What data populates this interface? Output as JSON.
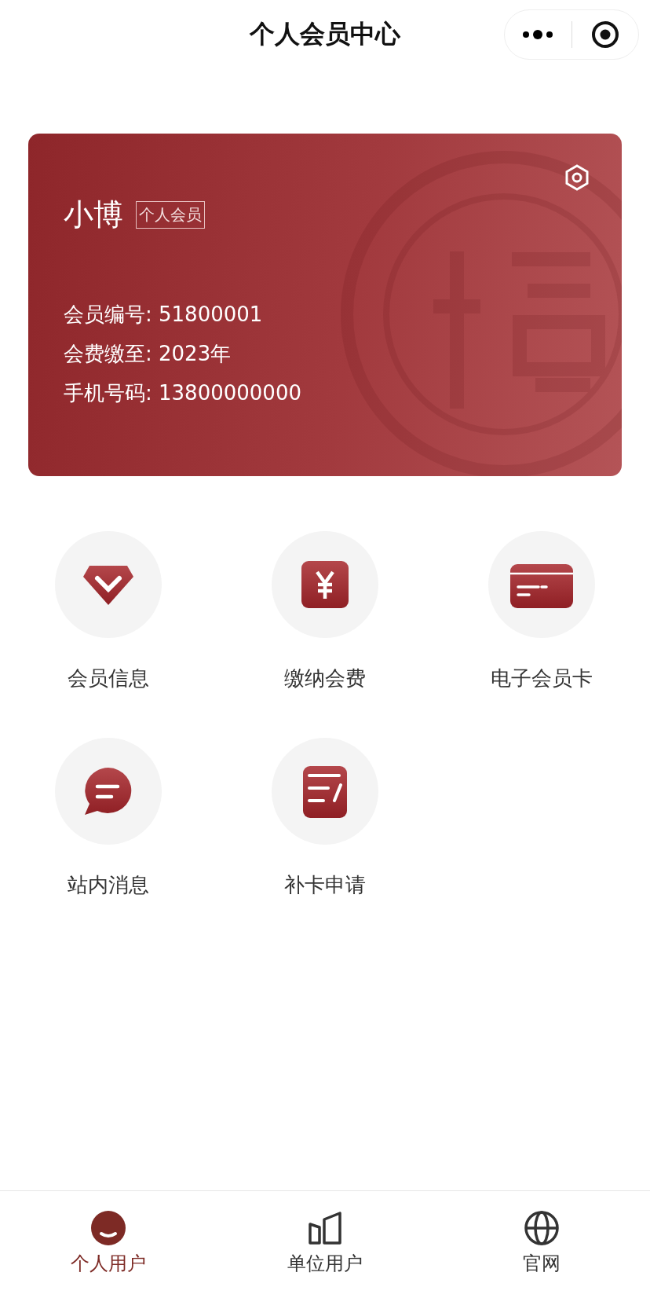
{
  "header": {
    "title": "个人会员中心"
  },
  "card": {
    "name": "小博",
    "badge": "个人会员",
    "lines": [
      "会员编号: 51800001",
      "会费缴至: 2023年",
      "手机号码: 13800000000"
    ]
  },
  "menu": [
    {
      "kind": "gem",
      "label": "会员信息"
    },
    {
      "kind": "yuan",
      "label": "缴纳会费"
    },
    {
      "kind": "card",
      "label": "电子会员卡"
    },
    {
      "kind": "chat",
      "label": "站内消息"
    },
    {
      "kind": "form",
      "label": "补卡申请"
    }
  ],
  "tabbar": [
    {
      "kind": "person",
      "label": "个人用户",
      "selected": true
    },
    {
      "kind": "building",
      "label": "单位用户",
      "selected": false
    },
    {
      "kind": "globe",
      "label": "官网",
      "selected": false
    }
  ]
}
